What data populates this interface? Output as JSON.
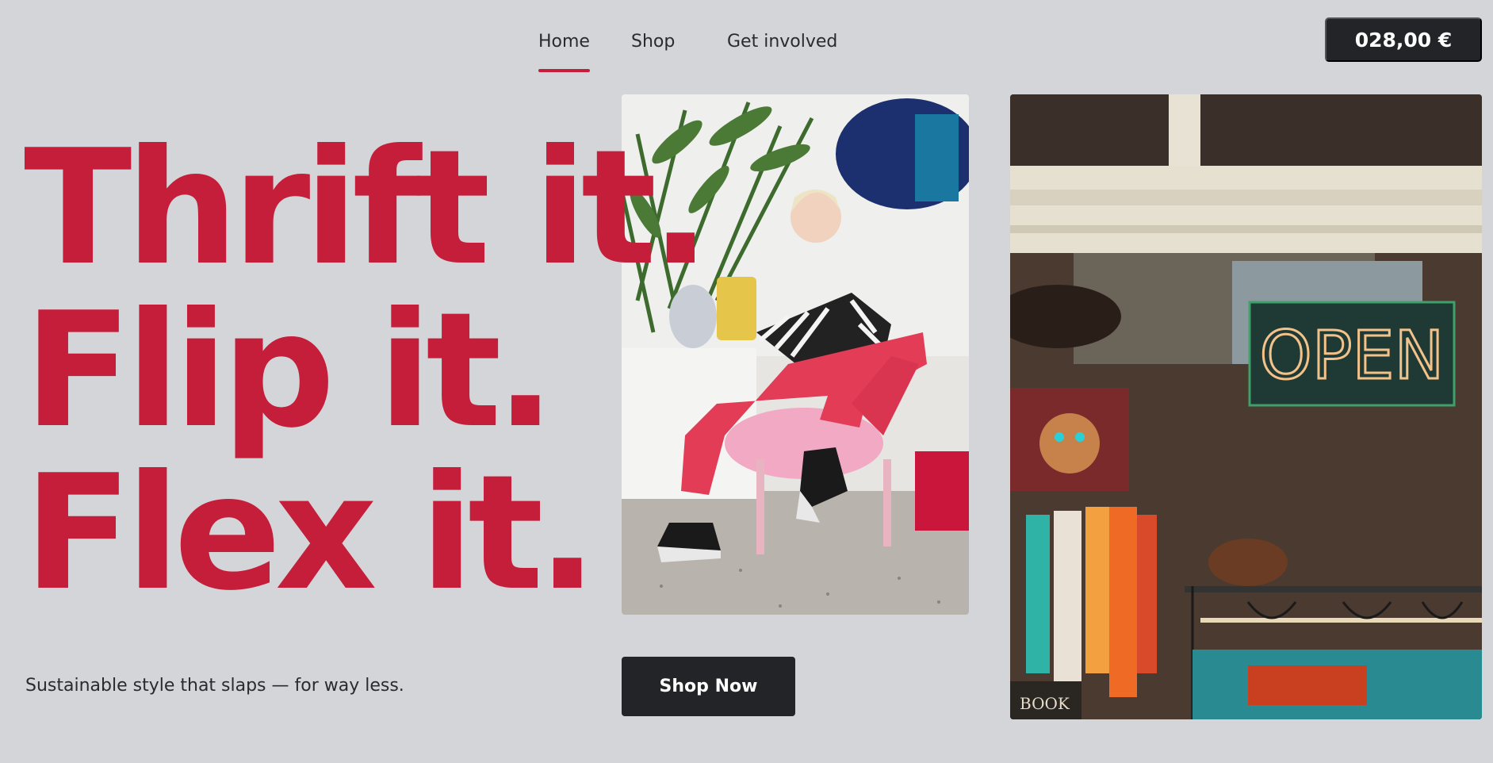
{
  "nav": {
    "home": "Home",
    "shop": "Shop",
    "get_involved": "Get involved"
  },
  "cart": {
    "total": "028,00 €"
  },
  "hero": {
    "line1": "Thrift it.",
    "line2": "Flip it.",
    "line3": "Flex it.",
    "tagline": "Sustainable style that slaps — for way less.",
    "cta": "Shop Now"
  },
  "photos": {
    "storefront_sign": "OPEN",
    "book_sign": "BOOK"
  },
  "colors": {
    "accent": "#c41e3a",
    "background": "#d4d5d9",
    "dark": "#232428"
  }
}
